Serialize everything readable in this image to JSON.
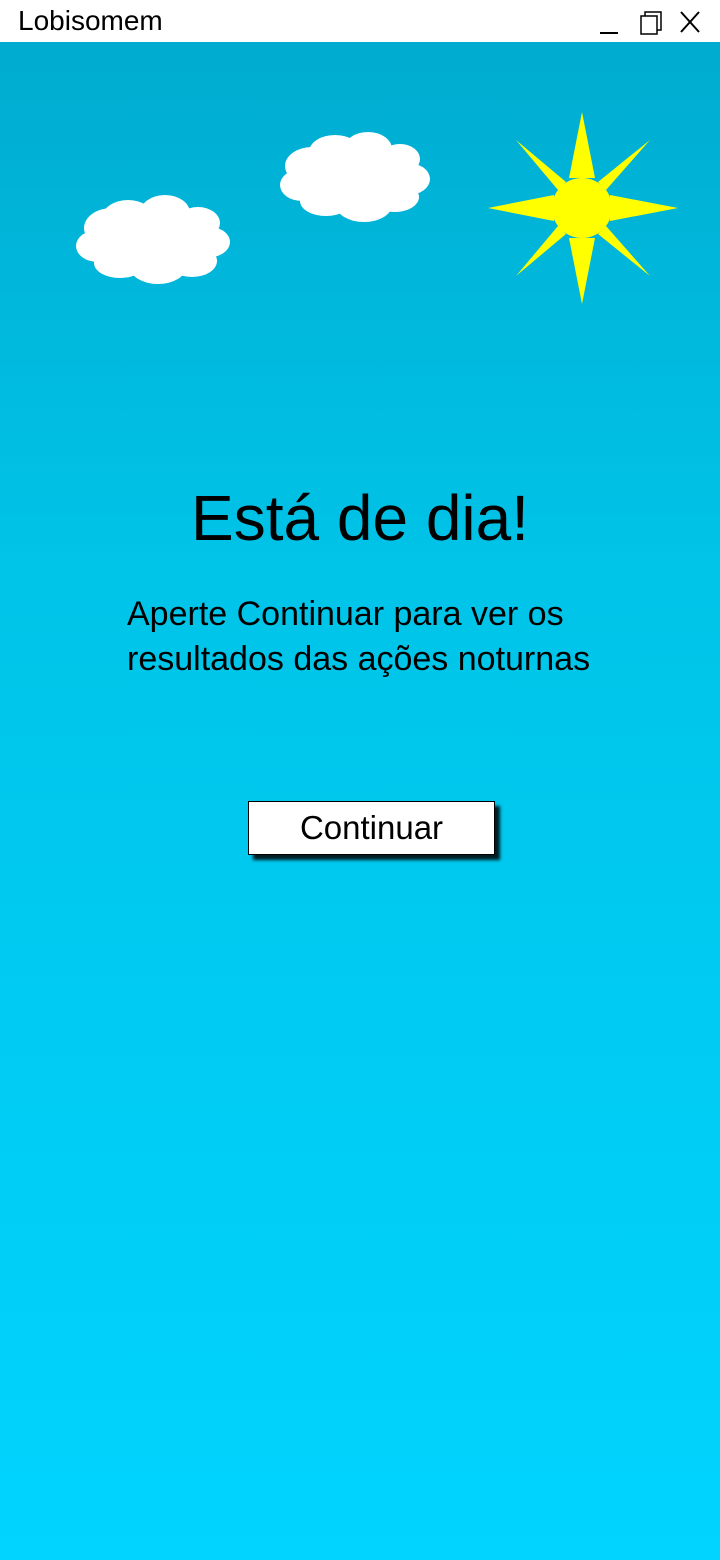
{
  "window": {
    "title": "Lobisomem"
  },
  "main": {
    "heading": "Está de dia!",
    "message_line1": "Aperte Continuar para ver os",
    "message_line2": "resultados das ações noturnas",
    "continue_label": "Continuar"
  },
  "colors": {
    "sky_top": "#00acd0",
    "sky_bottom": "#00d4ff",
    "sun": "#ffff00",
    "cloud": "#ffffff"
  },
  "icons": {
    "minimize": "minimize-icon",
    "maximize": "maximize-icon",
    "close": "close-icon",
    "sun": "sun-icon",
    "cloud": "cloud-icon"
  }
}
